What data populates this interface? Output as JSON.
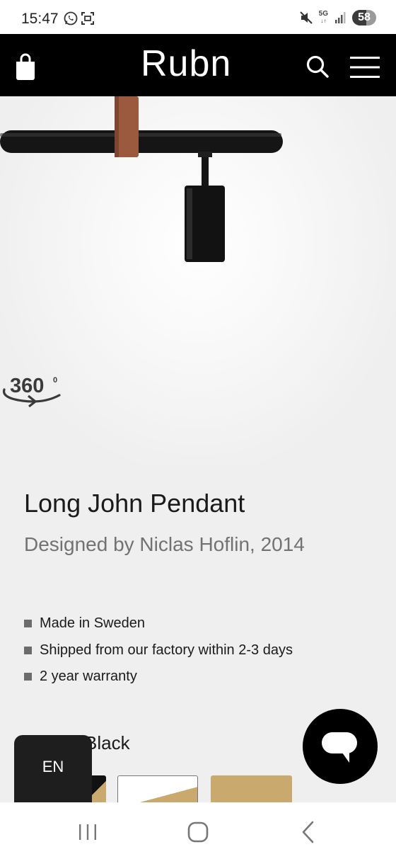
{
  "status_bar": {
    "time": "15:47",
    "network": "5G",
    "battery": "58",
    "battery_level": 0.58
  },
  "header": {
    "logo": "Rubn",
    "icons": [
      "shopping-bag-icon",
      "search-icon",
      "hamburger-menu-icon"
    ]
  },
  "hero": {
    "badge_icon": "rotate-360-icon",
    "badge_text": "360",
    "badge_superscript": "0"
  },
  "product": {
    "title": "Long John Pendant",
    "designer": "Designed by Niclas Hoflin, 2014",
    "features": [
      "Made in Sweden",
      "Shipped from our factory within 2-3 days",
      "2 year warranty"
    ],
    "selected_color_label": "Black"
  },
  "swatches": [
    {
      "name": "black-brass",
      "colors": [
        "#111111",
        "#c9a96e"
      ]
    },
    {
      "name": "white-brass",
      "colors": [
        "#ffffff",
        "#c9a96e"
      ]
    },
    {
      "name": "brass",
      "colors": [
        "#c9a96e"
      ]
    }
  ],
  "language_button": {
    "label": "EN"
  },
  "chat_button": {
    "icon": "chat-bubble-icon"
  },
  "nav_bar": {
    "icons": [
      "recent-apps-icon",
      "home-icon",
      "back-icon"
    ]
  },
  "colors": {
    "header_bg": "#000000",
    "page_bg": "#efeff0",
    "brass": "#c9a96e",
    "leather": "#9b5a3e"
  }
}
